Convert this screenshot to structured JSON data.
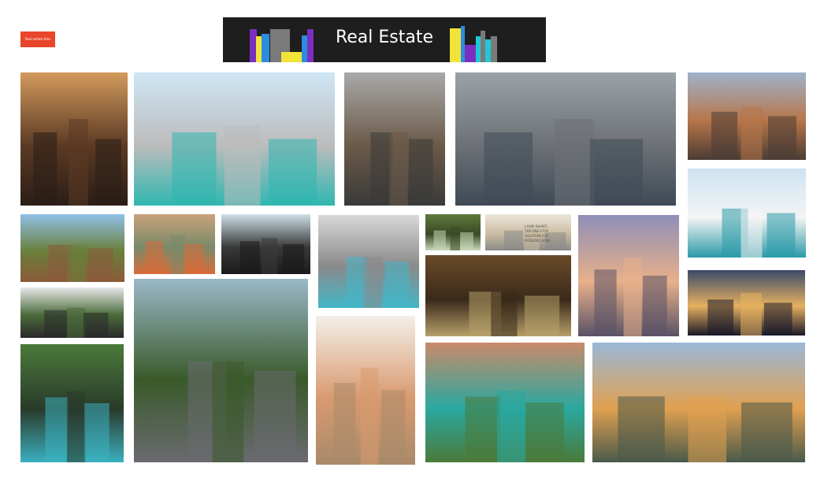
{
  "header": {
    "category_button_label": "Real estate tiles",
    "banner_title": "Real Estate",
    "banner_colors": [
      "#7b2fbe",
      "#2a8de0",
      "#f2e33b",
      "#7a7a7a",
      "#22c7d6",
      "#1e1e1e"
    ]
  },
  "gallery": {
    "tiles": [
      {
        "name": "tile-dining-room-sunset",
        "colors": [
          "#d39a5c",
          "#5b3a24",
          "#2a1d16"
        ]
      },
      {
        "name": "tile-pool-villa",
        "colors": [
          "#cfe6f5",
          "#bcbcbc",
          "#2fb7b0"
        ]
      },
      {
        "name": "tile-modern-living-room",
        "colors": [
          "#a9a9a9",
          "#6b5a48",
          "#3a3a3a"
        ]
      },
      {
        "name": "tile-city-highrises",
        "colors": [
          "#9aa2a8",
          "#6d7176",
          "#3f4a55"
        ]
      },
      {
        "name": "tile-office-towers",
        "colors": [
          "#9fb3cc",
          "#b7764a",
          "#4b3c34"
        ]
      },
      {
        "name": "tile-tropical-cabin",
        "colors": [
          "#8fc0e8",
          "#6a7f3a",
          "#8a5a3a"
        ]
      },
      {
        "name": "tile-aerial-neighborhood",
        "colors": [
          "#c8a27a",
          "#7a8a6a",
          "#d96c3a"
        ]
      },
      {
        "name": "tile-terrace-seaview",
        "colors": [
          "#cfe0e8",
          "#3a3a3a",
          "#1a1a1a"
        ]
      },
      {
        "name": "tile-modern-house-pool",
        "colors": [
          "#d9d9d9",
          "#8a8a8a",
          "#43b6c8"
        ]
      },
      {
        "name": "tile-forest-path",
        "colors": [
          "#5d7a3a",
          "#3a4a26",
          "#c9d8b8"
        ]
      },
      {
        "name": "tile-apartment-brochure",
        "colors": [
          "#ece7dc",
          "#c9bba0",
          "#8a8a8a"
        ]
      },
      {
        "name": "tile-glass-villa-dusk",
        "colors": [
          "#cfe3f2",
          "#f4f4f4",
          "#2a9aa8"
        ]
      },
      {
        "name": "tile-window-bath-skyline",
        "colors": [
          "#8f8fb8",
          "#e8b08a",
          "#5a5266"
        ]
      },
      {
        "name": "tile-glass-house-interior",
        "colors": [
          "#e8e8e8",
          "#4a6a3a",
          "#2a2a2a"
        ]
      },
      {
        "name": "tile-wooden-pavilion",
        "colors": [
          "#6a4a2a",
          "#3a2a1a",
          "#b7a06a"
        ]
      },
      {
        "name": "tile-house-night-lights",
        "colors": [
          "#3a4a6a",
          "#e6b060",
          "#1a1a2a"
        ]
      },
      {
        "name": "tile-treehouse-pool",
        "colors": [
          "#4a7a3a",
          "#2a3a2a",
          "#3ab0c0"
        ]
      },
      {
        "name": "tile-aerial-central-park",
        "colors": [
          "#9ab8c8",
          "#3a5a2a",
          "#6a6a70"
        ]
      },
      {
        "name": "tile-white-gable-lounge",
        "colors": [
          "#f3efe8",
          "#d99a70",
          "#a98a6a"
        ]
      },
      {
        "name": "tile-coastal-village",
        "colors": [
          "#c98a6a",
          "#2aa8a0",
          "#4a7a3a"
        ]
      },
      {
        "name": "tile-gabled-house-night",
        "colors": [
          "#9ab8d8",
          "#e0a050",
          "#4a5a4a"
        ]
      }
    ],
    "brochure_caption": [
      "LAXMI SHANTI",
      "THE ONE-STOP",
      "SOLUTION FOR",
      "MODERN LIVING"
    ]
  }
}
